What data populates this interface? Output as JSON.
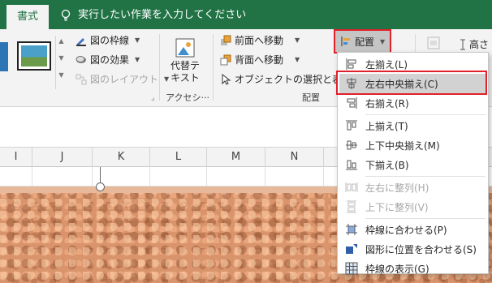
{
  "tabs": {
    "active": "書式",
    "tell_me": "実行したい作業を入力してください"
  },
  "ribbon": {
    "border_btn": "図の枠線",
    "effect_btn": "図の効果",
    "layout_btn": "図のレイアウト",
    "alt_text_line1": "代替テ",
    "alt_text_line2": "キスト",
    "accessibility_label": "アクセシ···",
    "bring_forward": "前面へ移動",
    "send_backward": "背面へ移動",
    "selection_pane": "オブジェクトの選択と表示",
    "arrange_label": "配置",
    "align_btn": "配置",
    "height_label": "高さ"
  },
  "columns": [
    "I",
    "J",
    "K",
    "L",
    "M",
    "N"
  ],
  "menu": {
    "items": [
      {
        "label": "左揃え(L)",
        "icon": "align-left-icon",
        "disabled": false,
        "highlight": false
      },
      {
        "label": "左右中央揃え(C)",
        "icon": "align-center-icon",
        "disabled": false,
        "highlight": true
      },
      {
        "label": "右揃え(R)",
        "icon": "align-right-icon",
        "disabled": false,
        "highlight": false
      },
      {
        "label": "上揃え(T)",
        "icon": "align-top-icon",
        "disabled": false,
        "highlight": false
      },
      {
        "label": "上下中央揃え(M)",
        "icon": "align-middle-icon",
        "disabled": false,
        "highlight": false
      },
      {
        "label": "下揃え(B)",
        "icon": "align-bottom-icon",
        "disabled": false,
        "highlight": false
      },
      {
        "label": "左右に整列(H)",
        "icon": "distribute-horizontal-icon",
        "disabled": true,
        "highlight": false
      },
      {
        "label": "上下に整列(V)",
        "icon": "distribute-vertical-icon",
        "disabled": true,
        "highlight": false
      },
      {
        "label": "枠線に合わせる(P)",
        "icon": "snap-to-grid-icon",
        "disabled": false,
        "highlight": false
      },
      {
        "label": "図形に位置を合わせる(S)",
        "icon": "snap-to-shape-icon",
        "disabled": false,
        "highlight": false
      },
      {
        "label": "枠線の表示(G)",
        "icon": "view-gridlines-icon",
        "disabled": false,
        "highlight": false
      }
    ]
  },
  "colors": {
    "brand": "#217346",
    "highlight_border": "#e0202a"
  }
}
